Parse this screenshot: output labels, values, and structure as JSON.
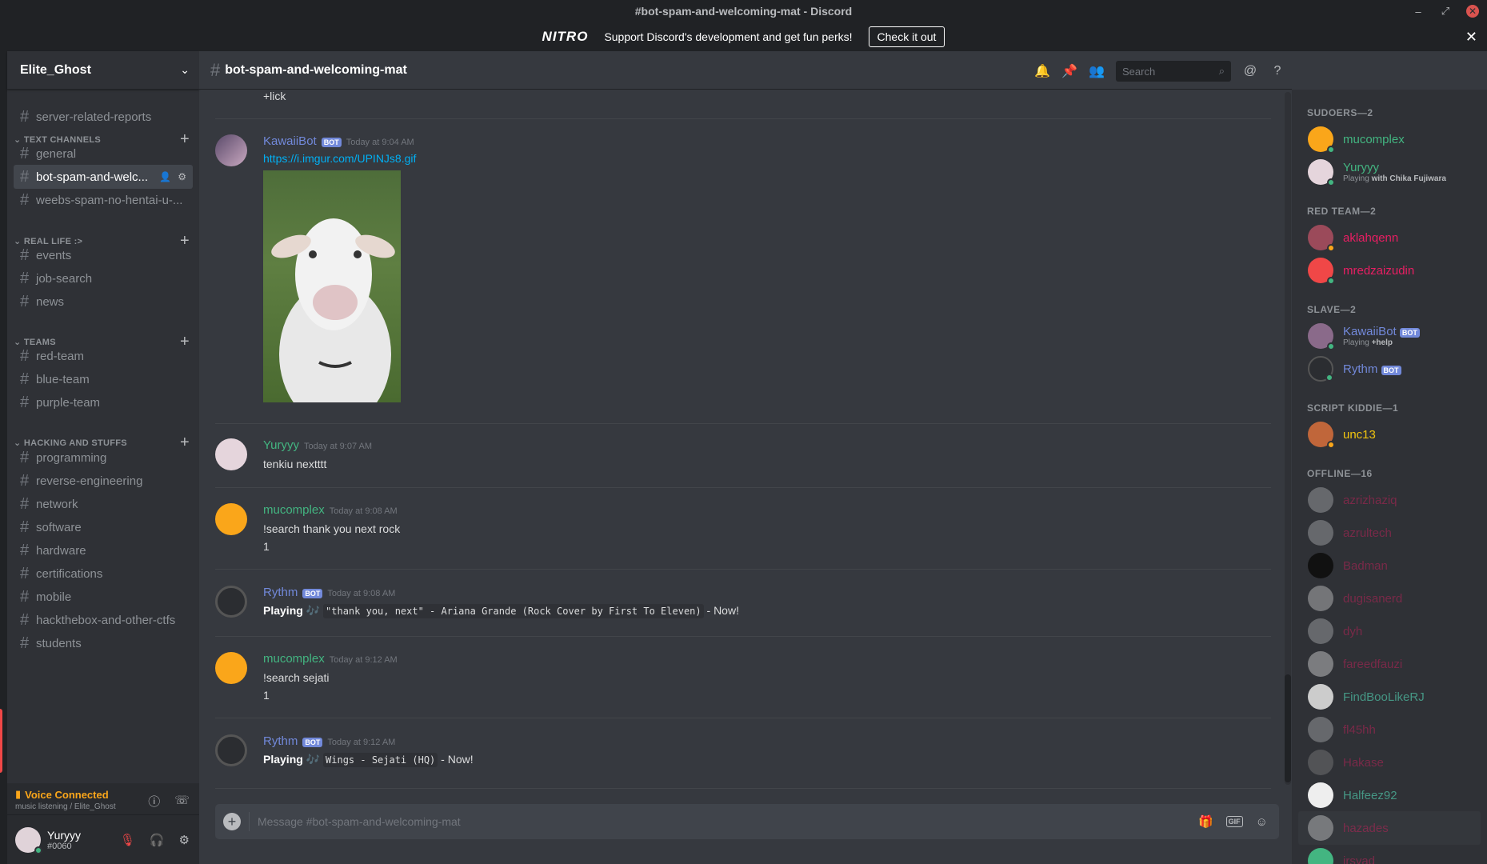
{
  "window": {
    "title": "#bot-spam-and-welcoming-mat - Discord"
  },
  "nitro": {
    "logo": "NITRO",
    "text": "Support Discord's development and get fun perks!",
    "button": "Check it out"
  },
  "server": {
    "name": "Elite_Ghost"
  },
  "channels": {
    "top": {
      "name": "server-related-reports"
    },
    "cat_text": "TEXT CHANNELS",
    "text": [
      "general",
      "bot-spam-and-welc...",
      "weebs-spam-no-hentai-u-..."
    ],
    "cat_reallife": "REAL LIFE :>",
    "reallife": [
      "events",
      "job-search",
      "news"
    ],
    "cat_teams": "TEAMS",
    "teams": [
      "red-team",
      "blue-team",
      "purple-team"
    ],
    "cat_hacking": "HACKING AND STUFFS",
    "hacking": [
      "programming",
      "reverse-engineering",
      "network",
      "software",
      "hardware",
      "certifications",
      "mobile",
      "hackthebox-and-other-ctfs",
      "students"
    ]
  },
  "voice": {
    "status": "Voice Connected",
    "sub": "music listening / Elite_Ghost"
  },
  "user": {
    "name": "Yuryyy",
    "tag": "#0060"
  },
  "header": {
    "channel": "bot-spam-and-welcoming-mat",
    "search_placeholder": "Search"
  },
  "messages": {
    "top_line": "+lick",
    "m1": {
      "user": "KawaiiBot",
      "badge": "BOT",
      "time": "Today at 9:04 AM",
      "link": "https://i.imgur.com/UPINJs8.gif"
    },
    "m2": {
      "user": "Yuryyy",
      "time": "Today at 9:07 AM",
      "text": "tenkiu nextttt"
    },
    "m3": {
      "user": "mucomplex",
      "time": "Today at 9:08 AM",
      "text": "!search thank you next rock",
      "text2": "1"
    },
    "m4": {
      "user": "Rythm",
      "badge": "BOT",
      "time": "Today at 9:08 AM",
      "playing": "Playing",
      "song": "\"thank you, next\" - Ariana Grande (Rock Cover by First To Eleven)",
      "now": " - Now!"
    },
    "m5": {
      "user": "mucomplex",
      "time": "Today at 9:12 AM",
      "text": "!search sejati",
      "text2": "1"
    },
    "m6": {
      "user": "Rythm",
      "badge": "BOT",
      "time": "Today at 9:12 AM",
      "playing": "Playing",
      "song": "Wings - Sejati (HQ)",
      "now": " - Now!"
    }
  },
  "composer": {
    "placeholder": "Message #bot-spam-and-welcoming-mat",
    "gif": "GIF"
  },
  "members": {
    "cat_sudoers": "SUDOERS—2",
    "sudoers": [
      {
        "name": "mucomplex"
      },
      {
        "name": "Yuryyy",
        "activity_prefix": "Playing ",
        "activity": "with Chika Fujiwara"
      }
    ],
    "cat_red": "RED TEAM—2",
    "red": [
      {
        "name": "aklahqenn"
      },
      {
        "name": "mredzaizudin"
      }
    ],
    "cat_slave": "SLAVE—2",
    "slave": [
      {
        "name": "KawaiiBot",
        "badge": "BOT",
        "activity_prefix": "Playing ",
        "activity": "+help"
      },
      {
        "name": "Rythm",
        "badge": "BOT"
      }
    ],
    "cat_script": "SCRIPT KIDDIE—1",
    "script": [
      {
        "name": "unc13"
      }
    ],
    "cat_offline": "OFFLINE—16",
    "offline": [
      "azrizhaziq",
      "azrultech",
      "Badman",
      "dugisanerd",
      "dyh",
      "fareedfauzi",
      "FindBooLikeRJ",
      "fl45hh",
      "Hakase",
      "Halfeez92",
      "hazades",
      "irsyad"
    ]
  },
  "colors": {
    "green": "#43b581",
    "red": "#e91e63",
    "yellow": "#f1c40f",
    "bot_name": "#7289da",
    "mod": "#4fc1a6"
  }
}
